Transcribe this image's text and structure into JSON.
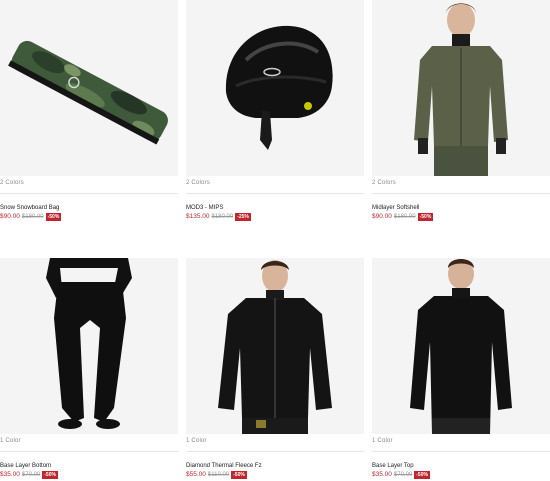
{
  "products": [
    {
      "colors": "2 Colors",
      "name": "Snow Snowboard Bag",
      "price": "$90.00",
      "old_price": "$180.00",
      "discount": "-50%"
    },
    {
      "colors": "2 Colors",
      "name": "MOD3 - MIPS",
      "price": "$135.00",
      "old_price": "$180.00",
      "discount": "-25%"
    },
    {
      "colors": "2 Colors",
      "name": "Midlayer Softshell",
      "price": "$90.00",
      "old_price": "$180.00",
      "discount": "-50%"
    },
    {
      "colors": "1 Color",
      "name": "Base Layer Bottom",
      "price": "$35.00",
      "old_price": "$70.00",
      "discount": "-50%"
    },
    {
      "colors": "1 Color",
      "name": "Diamond Thermal Fleece Fz",
      "price": "$55.00",
      "old_price": "$110.00",
      "discount": "-50%"
    },
    {
      "colors": "1 Color",
      "name": "Base Layer Top",
      "price": "$35.00",
      "old_price": "$70.00",
      "discount": "-50%"
    }
  ],
  "colors": {
    "accent": "#c0262d",
    "image_bg": "#f4f4f4",
    "camo_green": "#3f5a3c",
    "jacket_olive": "#5b6148"
  }
}
